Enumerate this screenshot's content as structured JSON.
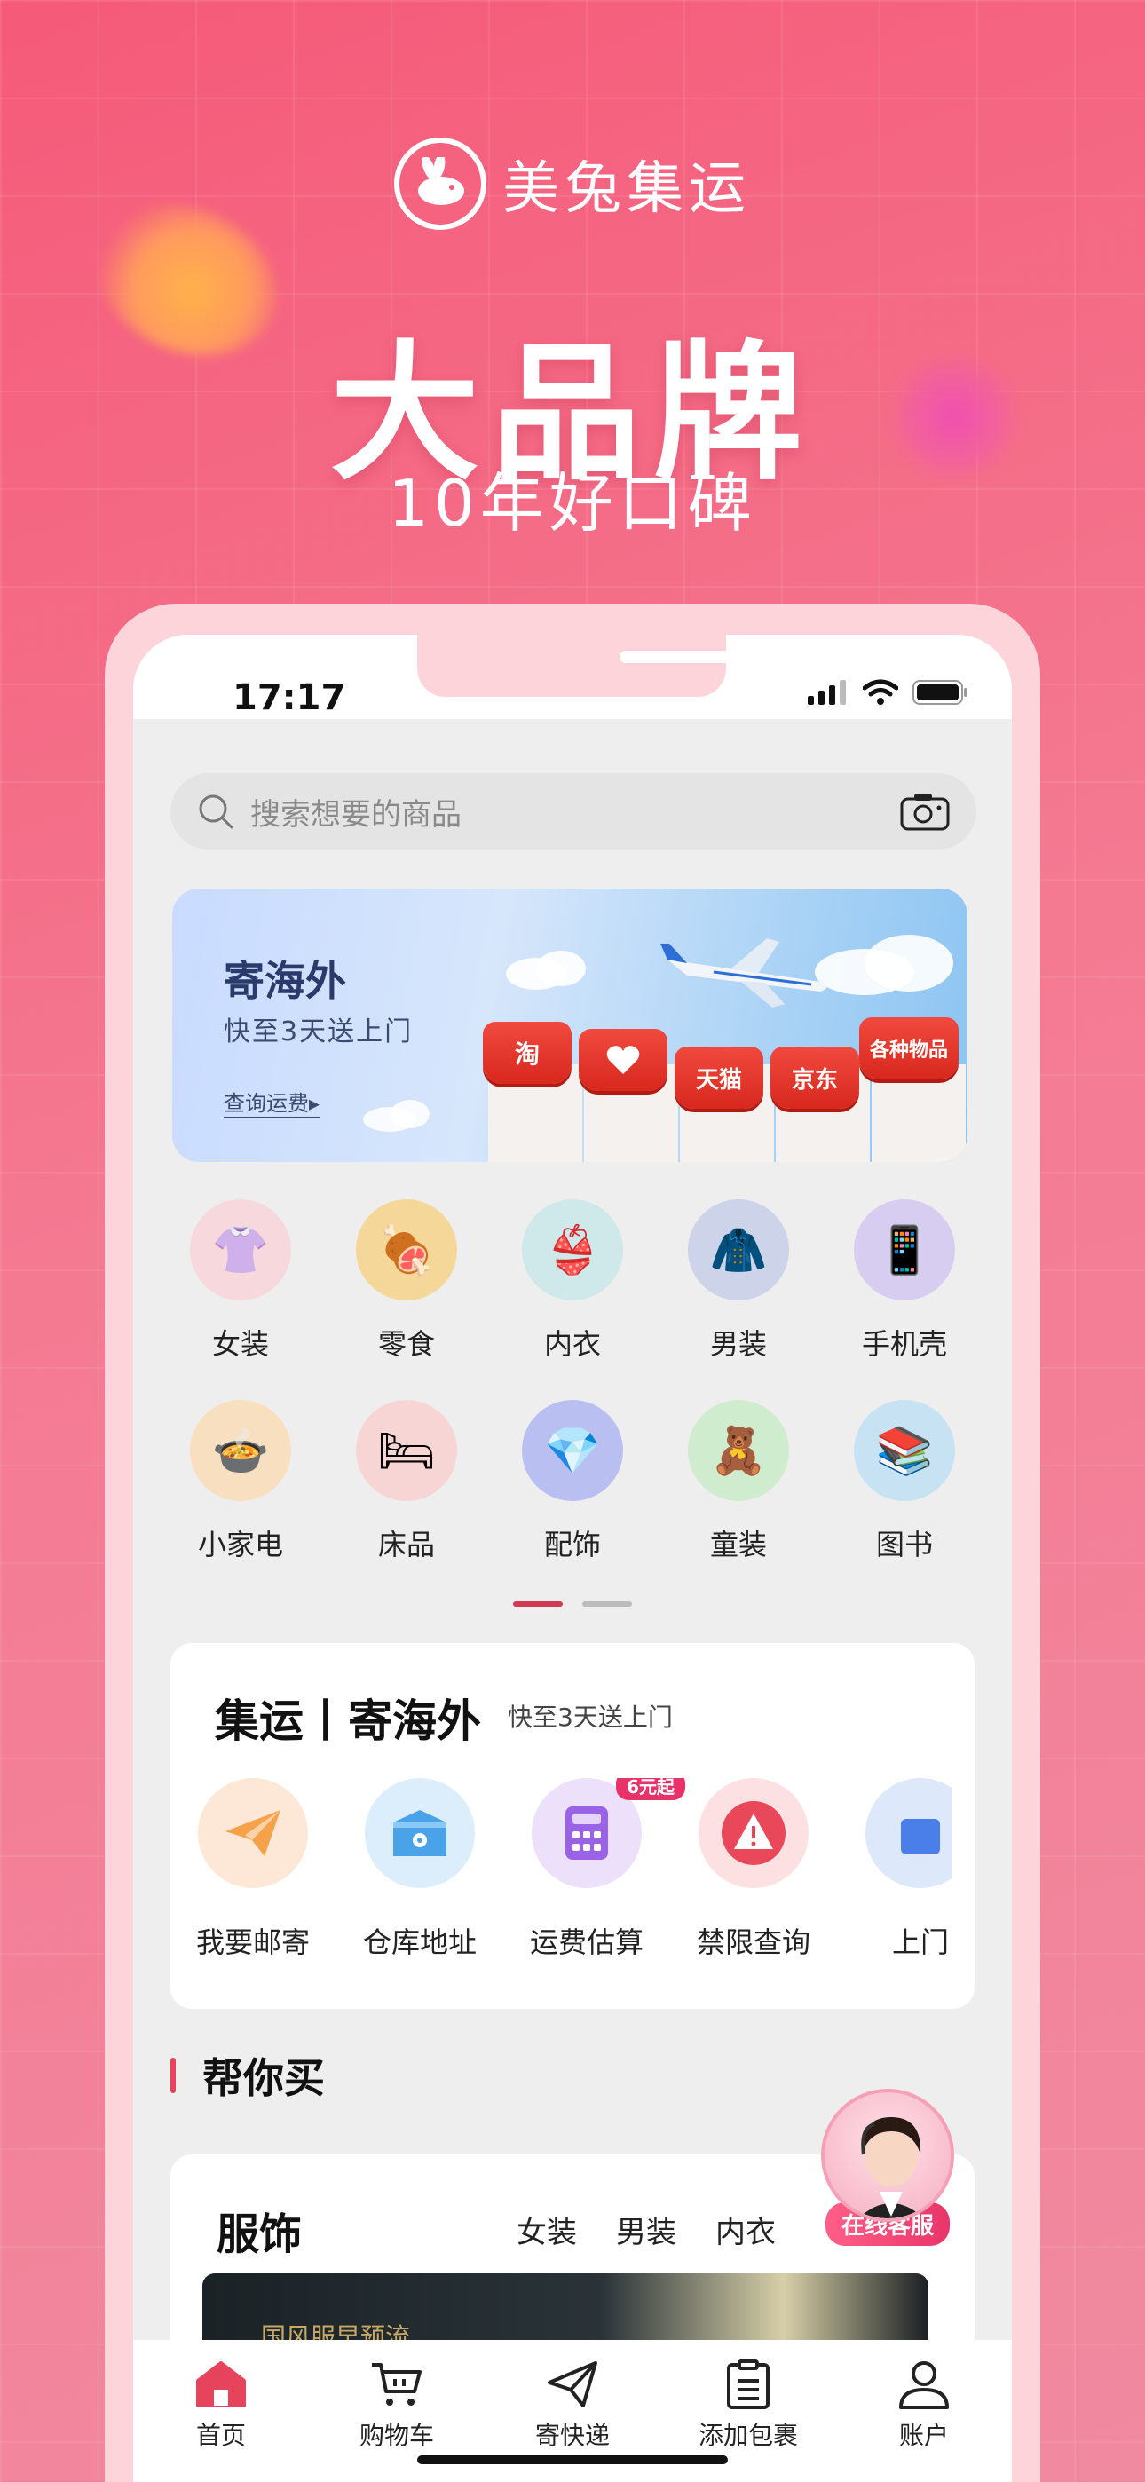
{
  "brand": {
    "name": "美兔集运"
  },
  "hero": {
    "headline": "大品牌",
    "subheadline": "10年好口碑"
  },
  "status_bar": {
    "time": "17:17"
  },
  "search": {
    "placeholder": "搜索想要的商品"
  },
  "banner": {
    "title": "寄海外",
    "subtitle": "快至3天送上门",
    "link": "查询运费▸",
    "stores": [
      "淘",
      "天猫",
      "京东",
      "各种物品"
    ]
  },
  "categories": [
    [
      {
        "label": "女装",
        "icon": "👚",
        "bg": "#f7d8dc"
      },
      {
        "label": "零食",
        "icon": "🍖",
        "bg": "#f6d79a"
      },
      {
        "label": "内衣",
        "icon": "👙",
        "bg": "#cfe8ea"
      },
      {
        "label": "男装",
        "icon": "🧥",
        "bg": "#cdd4ea"
      },
      {
        "label": "手机壳",
        "icon": "📱",
        "bg": "#d7cdf0"
      }
    ],
    [
      {
        "label": "小家电",
        "icon": "🍲",
        "bg": "#f8dfc0"
      },
      {
        "label": "床品",
        "icon": "🛏",
        "bg": "#f7d5d5"
      },
      {
        "label": "配饰",
        "icon": "💎",
        "bg": "#b9bff0"
      },
      {
        "label": "童装",
        "icon": "🧸",
        "bg": "#cfeccf"
      },
      {
        "label": "图书",
        "icon": "📚",
        "bg": "#c6e2f3"
      }
    ]
  ],
  "shipping_card": {
    "title": "集运丨寄海外",
    "subtitle": "快至3天送上门",
    "services": [
      {
        "label": "我要邮寄",
        "bg": "#fde7d6",
        "color": "#f6a24a"
      },
      {
        "label": "仓库地址",
        "bg": "#dceefc",
        "color": "#4aa3e8"
      },
      {
        "label": "运费估算",
        "bg": "#ece0fb",
        "color": "#9a62e6",
        "badge": "6元起"
      },
      {
        "label": "禁限查询",
        "bg": "#fde0e2",
        "color": "#e9485a"
      },
      {
        "label": "上门",
        "bg": "#dde8fb",
        "color": "#4a7ee8"
      }
    ]
  },
  "help_buy": {
    "title": "帮你买"
  },
  "clothing": {
    "title": "服饰",
    "tabs": [
      "女装",
      "男装",
      "内衣"
    ],
    "banner_text": "国风服早预流"
  },
  "customer_service": {
    "label": "在线客服"
  },
  "tabbar": [
    {
      "label": "首页",
      "icon": "home-icon",
      "active": true
    },
    {
      "label": "购物车",
      "icon": "cart-icon"
    },
    {
      "label": "寄快递",
      "icon": "send-icon"
    },
    {
      "label": "添加包裹",
      "icon": "package-icon"
    },
    {
      "label": "账户",
      "icon": "account-icon"
    }
  ],
  "colors": {
    "accent": "#e5445c",
    "bg_pink": "#f55a78"
  }
}
